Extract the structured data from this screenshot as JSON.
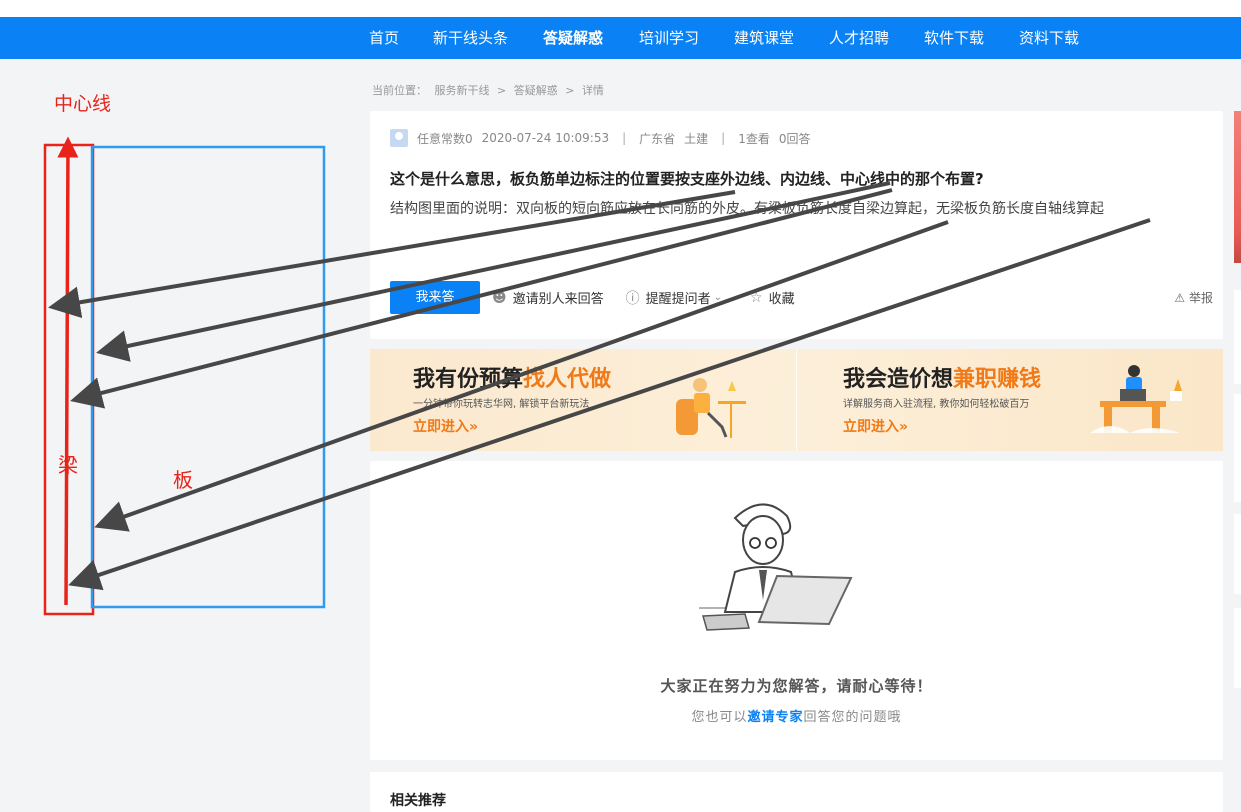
{
  "nav": {
    "items": [
      {
        "label": "首页",
        "active": false
      },
      {
        "label": "新干线头条",
        "active": false
      },
      {
        "label": "答疑解惑",
        "active": true
      },
      {
        "label": "培训学习",
        "active": false
      },
      {
        "label": "建筑课堂",
        "active": false
      },
      {
        "label": "人才招聘",
        "active": false
      },
      {
        "label": "软件下载",
        "active": false
      },
      {
        "label": "资料下载",
        "active": false
      }
    ]
  },
  "breadcrumb": {
    "prefix": "当前位置：",
    "items": [
      "服务新干线",
      "答疑解惑",
      "详情"
    ],
    "separator": ">"
  },
  "question": {
    "user": "任意常数0",
    "datetime": "2020-07-24 10:09:53",
    "location": "广东省",
    "category": "土建",
    "views": "1查看",
    "answers": "0回答",
    "title": "这个是什么意思，板负筋单边标注的位置要按支座外边线、内边线、中心线中的那个布置?",
    "body": " 结构图里面的说明：双向板的短向筋应放在长向筋的外皮。有梁板负筋长度自梁边算起，无梁板负筋长度自轴线算起",
    "actions": {
      "answer_button": "我来答",
      "invite": "邀请别人来回答",
      "remind": "提醒提问者",
      "favorite": "收藏",
      "report": "举报"
    }
  },
  "banner": {
    "left": {
      "heading_main": "我有份预算",
      "heading_highlight": "找人代做",
      "subtitle": "一分钟带你玩转志华网, 解锁平台新玩法",
      "cta": "立即进入»"
    },
    "right": {
      "heading_main": "我会造价想",
      "heading_highlight": "兼职赚钱",
      "subtitle": "详解服务商入驻流程, 教你如何轻松破百万",
      "cta": "立即进入»"
    }
  },
  "empty_state": {
    "title": "大家正在努力为您解答，请耐心等待！",
    "sub_before": "您也可以",
    "sub_link": "邀请专家",
    "sub_after": "回答您的问题哦"
  },
  "next_section": {
    "title": "相关推荐"
  },
  "annotation": {
    "centerline_label": "中心线",
    "beam_label": "梁",
    "slab_label": "板"
  },
  "colors": {
    "nav_blue": "#0a82f5",
    "annotation_red": "#e8241a",
    "slab_blue": "#2e9bf0",
    "arrow_gray": "#474747",
    "banner_orange": "#f07a18"
  }
}
